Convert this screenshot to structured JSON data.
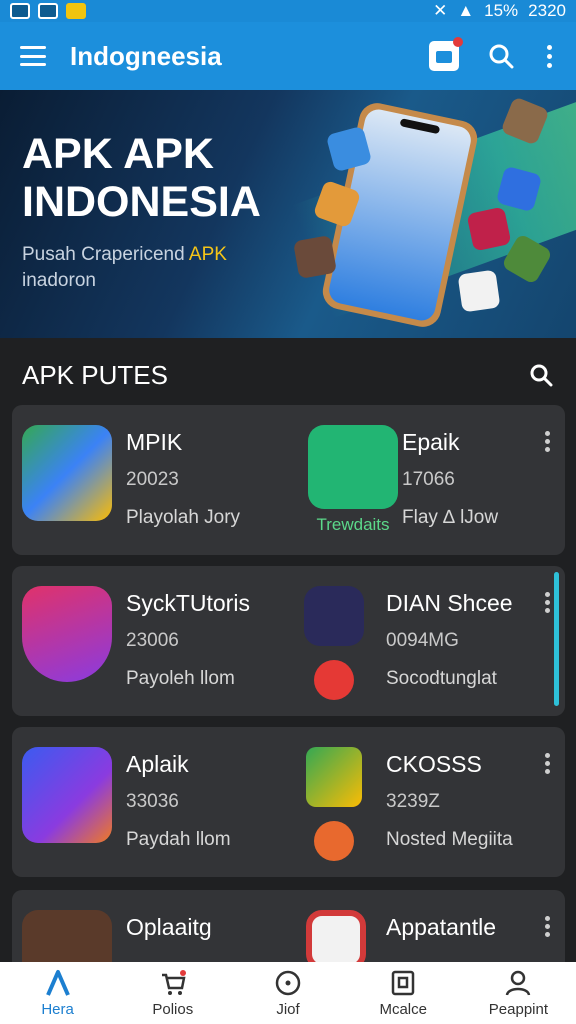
{
  "status_bar": {
    "battery": "15%",
    "time": "2320"
  },
  "app_bar": {
    "title": "Indogneesia"
  },
  "banner": {
    "title_line1": "APK APK",
    "title_line2": "INDONESIA",
    "subtitle_part1": "Pusah Crapericend ",
    "subtitle_highlight": "APK",
    "subtitle_line2": "inadoron"
  },
  "section": {
    "title": "APK PUTES"
  },
  "apps": [
    {
      "name": "MPIK",
      "number": "20023",
      "publisher": "Playolah Jory",
      "icon": "drive-icon",
      "color": "#3b82f6"
    },
    {
      "name": "Epaik",
      "number": "17066",
      "publisher": "Flay ∆ lJow",
      "icon": "checkmark-app-icon",
      "color": "#22b573",
      "tag": "Trewdaits"
    },
    {
      "name": "SyckTUtoris",
      "number": "23006",
      "publisher": "Payoleh llom",
      "icon": "shield-a-icon",
      "color": "#c03bd1"
    },
    {
      "name": "DIAN Shcee",
      "number": "0094MG",
      "publisher": "Socodtunglat",
      "icon": "cartoon-fish-icon",
      "color": "#f08a24"
    },
    {
      "name": "Aplaik",
      "number": "33036",
      "publisher": "Paydah llom",
      "icon": "a-letter-icon",
      "color": "#6a5cf0"
    },
    {
      "name": "CKOSSS",
      "number": "3239Z",
      "publisher": "Nosted Megiita",
      "icon": "maps-icon",
      "color": "#34a853"
    },
    {
      "name": "Oplaaitg",
      "number": "",
      "publisher": "",
      "icon": "portrait-icon",
      "color": "#5a3a2a"
    },
    {
      "name": "Appatantle",
      "number": "",
      "publisher": "",
      "icon": "red-app-icon",
      "color": "#d23a3a"
    }
  ],
  "bottom_nav": [
    {
      "label": "Hera",
      "icon": "home-a-icon",
      "active": true
    },
    {
      "label": "Polios",
      "icon": "cart-icon"
    },
    {
      "label": "Jiof",
      "icon": "circle-dot-icon"
    },
    {
      "label": "Mcalce",
      "icon": "document-icon"
    },
    {
      "label": "Peappint",
      "icon": "person-icon"
    }
  ]
}
